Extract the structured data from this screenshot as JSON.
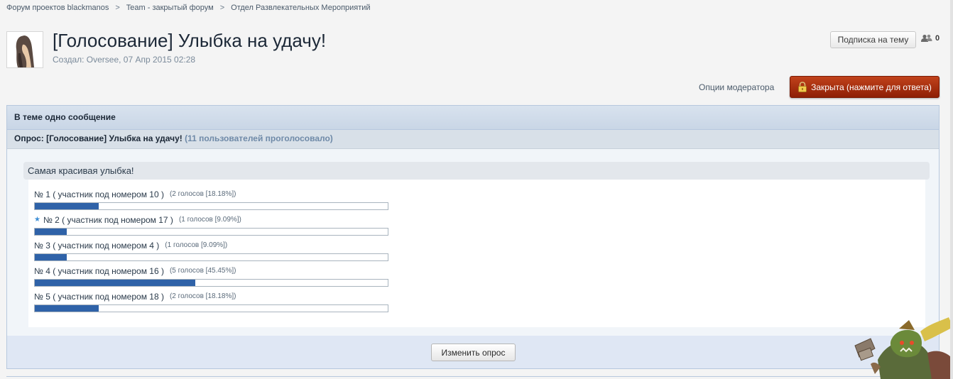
{
  "breadcrumb": {
    "items": [
      "Форум проектов blackmanos",
      "Team - закрытый форум",
      "Отдел Развлекательных Мероприятий"
    ],
    "separator": ">"
  },
  "topic": {
    "title": "[Голосование] Улыбка на удачу!",
    "meta": "Создал: Oversee, 07 Апр 2015 02:28"
  },
  "actions": {
    "subscribe_label": "Подписка на тему",
    "followers_count": "0",
    "moderator_options": "Опции модератора",
    "closed_label": "Закрыта (нажмите для ответа)"
  },
  "panel": {
    "header": "В теме одно сообщение",
    "poll_title": "Опрос: [Голосование] Улыбка на удачу!",
    "poll_voted": "(11 пользователей проголосовало)",
    "question": "Самая красивая улыбка!",
    "answers": [
      {
        "label": "№ 1 ( участник под номером 10 )",
        "votes": "(2 голосов [18.18%])",
        "percent": 18.18,
        "starred": false
      },
      {
        "label": "№ 2 ( участник под номером 17 )",
        "votes": "(1 голосов [9.09%])",
        "percent": 9.09,
        "starred": true
      },
      {
        "label": "№ 3 ( участник под номером 4 )",
        "votes": "(1 голосов [9.09%])",
        "percent": 9.09,
        "starred": false
      },
      {
        "label": "№ 4 ( участник под номером 16 )",
        "votes": "(5 голосов [45.45%])",
        "percent": 45.45,
        "starred": false
      },
      {
        "label": "№ 5 ( участник под номером 18 )",
        "votes": "(2 голосов [18.18%])",
        "percent": 18.18,
        "starred": false
      }
    ],
    "edit_poll_label": "Изменить опрос"
  },
  "colors": {
    "bar_fill": "#2f62a8",
    "closed_button": "#a8320f",
    "header_bg": "#d8e2ee"
  }
}
